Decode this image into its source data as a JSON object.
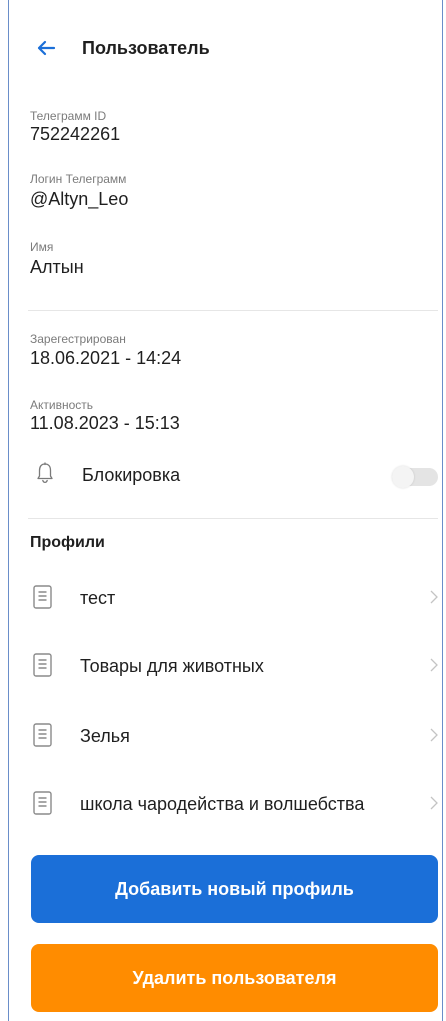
{
  "header": {
    "title": "Пользователь"
  },
  "fields": [
    {
      "label": "Телеграмм ID",
      "value": "752242261"
    },
    {
      "label": "Логин Телеграмм",
      "value": "@Altyn_Leo"
    },
    {
      "label": "Имя",
      "value": "Алтын"
    },
    {
      "label": "Зарегестрирован",
      "value": "18.06.2021 - 14:24"
    },
    {
      "label": "Активность",
      "value": "11.08.2023 - 15:13"
    }
  ],
  "block": {
    "label": "Блокировка",
    "enabled": false
  },
  "profiles": {
    "title": "Профили",
    "items": [
      {
        "name": "тест"
      },
      {
        "name": "Товары для животных"
      },
      {
        "name": "Зелья"
      },
      {
        "name": "школа чародейства и волшебства"
      }
    ]
  },
  "buttons": {
    "add_label": "Добавить новый профиль",
    "delete_label": "Удалить пользователя"
  },
  "colors": {
    "accent": "#1b6fd8",
    "add_button": "#1b6fd8",
    "delete_button": "#ff8c00",
    "frame": "#6a8ec9"
  },
  "icons": [
    "back-arrow-icon",
    "bell-icon",
    "document-icon",
    "chevron-right-icon"
  ]
}
